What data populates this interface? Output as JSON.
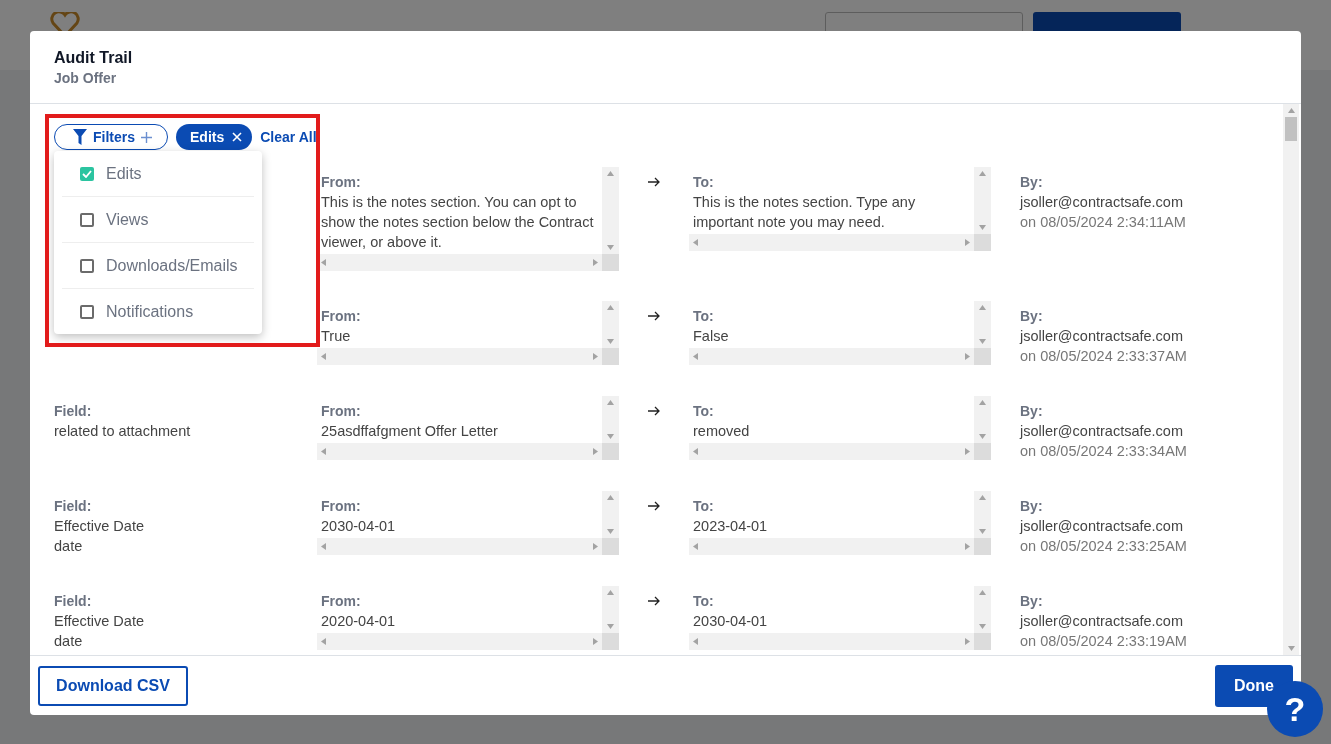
{
  "dialog": {
    "title": "Audit Trail",
    "subtitle": "Job Offer"
  },
  "filters": {
    "button": "Filters",
    "chips": [
      {
        "label": "Edits"
      }
    ],
    "clear_all": "Clear All",
    "menu": [
      {
        "label": "Edits",
        "checked": true
      },
      {
        "label": "Views",
        "checked": false
      },
      {
        "label": "Downloads/Emails",
        "checked": false
      },
      {
        "label": "Notifications",
        "checked": false
      }
    ]
  },
  "entries": [
    {
      "from": {
        "label": "From:",
        "text": "This is the notes section. You can opt to show the notes section below the Contract viewer, or above it."
      },
      "to": {
        "label": "To:",
        "text": "This is the notes section. Type any important note you may need."
      },
      "by": {
        "label": "By:",
        "user": "jsoller@contractsafe.com",
        "date": "on 08/05/2024 2:34:11AM"
      }
    },
    {
      "from": {
        "label": "From:",
        "text": "True"
      },
      "to": {
        "label": "To:",
        "text": "False"
      },
      "by": {
        "label": "By:",
        "user": "jsoller@contractsafe.com",
        "date": "on 08/05/2024 2:33:37AM"
      }
    },
    {
      "field": {
        "label": "Field:",
        "lines": [
          "related to attachment"
        ]
      },
      "from": {
        "label": "From:",
        "text": "25asdffafgment Offer Letter"
      },
      "to": {
        "label": "To:",
        "text": "removed"
      },
      "by": {
        "label": "By:",
        "user": "jsoller@contractsafe.com",
        "date": "on 08/05/2024 2:33:34AM"
      }
    },
    {
      "field": {
        "label": "Field:",
        "lines": [
          "Effective Date",
          "date"
        ]
      },
      "from": {
        "label": "From:",
        "text": "2030-04-01"
      },
      "to": {
        "label": "To:",
        "text": "2023-04-01"
      },
      "by": {
        "label": "By:",
        "user": "jsoller@contractsafe.com",
        "date": "on 08/05/2024 2:33:25AM"
      }
    },
    {
      "field": {
        "label": "Field:",
        "lines": [
          "Effective Date",
          "date"
        ]
      },
      "from": {
        "label": "From:",
        "text": "2020-04-01"
      },
      "to": {
        "label": "To:",
        "text": "2030-04-01"
      },
      "by": {
        "label": "By:",
        "user": "jsoller@contractsafe.com",
        "date": "on 08/05/2024 2:33:19AM"
      }
    }
  ],
  "footer": {
    "download": "Download CSV",
    "done": "Done"
  },
  "help_button": "?"
}
